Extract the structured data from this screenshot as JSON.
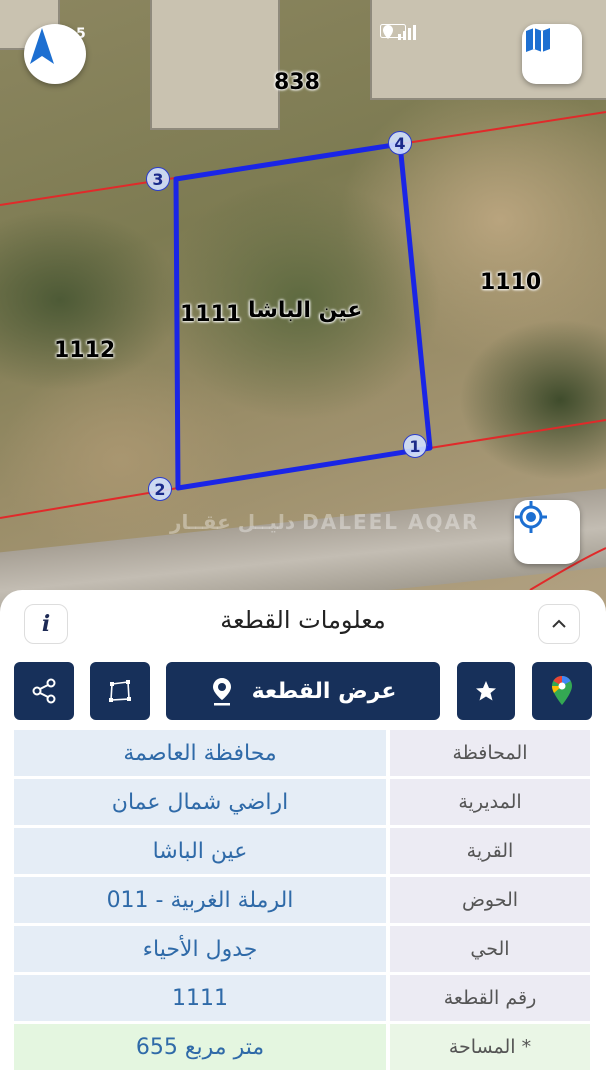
{
  "status_bar": {
    "left": "5"
  },
  "map": {
    "parcels": {
      "north": "838",
      "east": "1110",
      "west": "1112",
      "selected": "1111"
    },
    "selected_village_label": "عين الباشا",
    "vertices": [
      "1",
      "2",
      "3",
      "4"
    ],
    "watermark": "دليــل عقــار DALEEL AQAR",
    "colors": {
      "parcel_outline": "#1a25e6",
      "boundary_lines": "#e02a2a"
    }
  },
  "panel": {
    "title": "معلومات القطعة",
    "info_label": "i",
    "actions": {
      "view_parcel": "عرض القطعة"
    },
    "rows": [
      {
        "label": "المحافظة",
        "value": "محافظة العاصمة"
      },
      {
        "label": "المديرية",
        "value": "اراضي شمال عمان"
      },
      {
        "label": "القرية",
        "value": "عين الباشا"
      },
      {
        "label": "الحوض",
        "value": "الرملة الغربية - 011"
      },
      {
        "label": "الحي",
        "value": "جدول الأحياء"
      },
      {
        "label": "رقم القطعة",
        "value": "1111"
      },
      {
        "label": "المساحة *",
        "value": "655  متر مربع"
      }
    ]
  }
}
